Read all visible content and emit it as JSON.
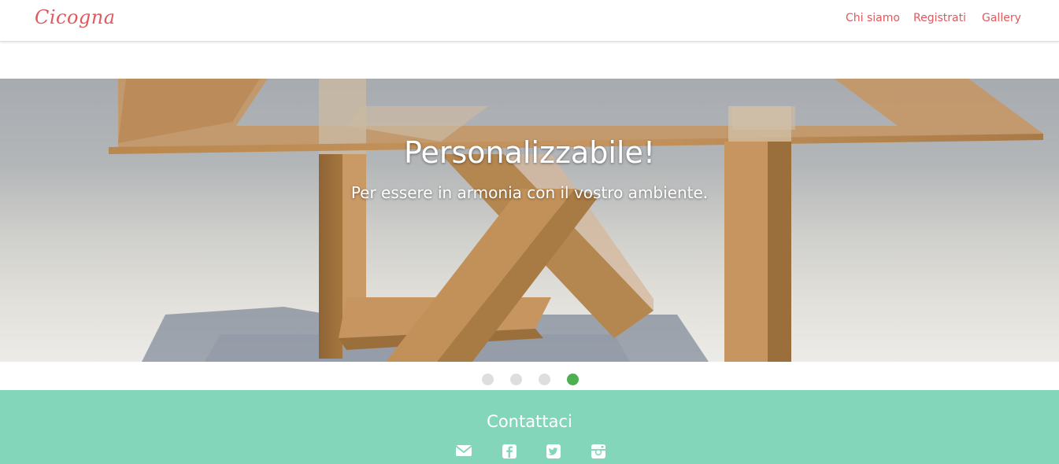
{
  "navbar": {
    "brand": "Cicogna",
    "links": [
      {
        "label": "Chi siamo"
      },
      {
        "label": "Registrati"
      },
      {
        "label": "Gallery"
      }
    ]
  },
  "carousel": {
    "slide": {
      "title": "Personalizzabile!",
      "subtitle": "Per essere in armonia con il vostro ambiente."
    },
    "indicator_count": 4,
    "active_index": 3
  },
  "contact": {
    "title": "Contattaci",
    "icons": [
      "envelope-icon",
      "facebook-icon",
      "twitter-icon",
      "instagram-icon"
    ]
  },
  "colors": {
    "accent": "#e0595e",
    "contact_bg": "#84d6ba",
    "indicator_active": "#4caf50",
    "indicator_inactive": "#dedede"
  }
}
